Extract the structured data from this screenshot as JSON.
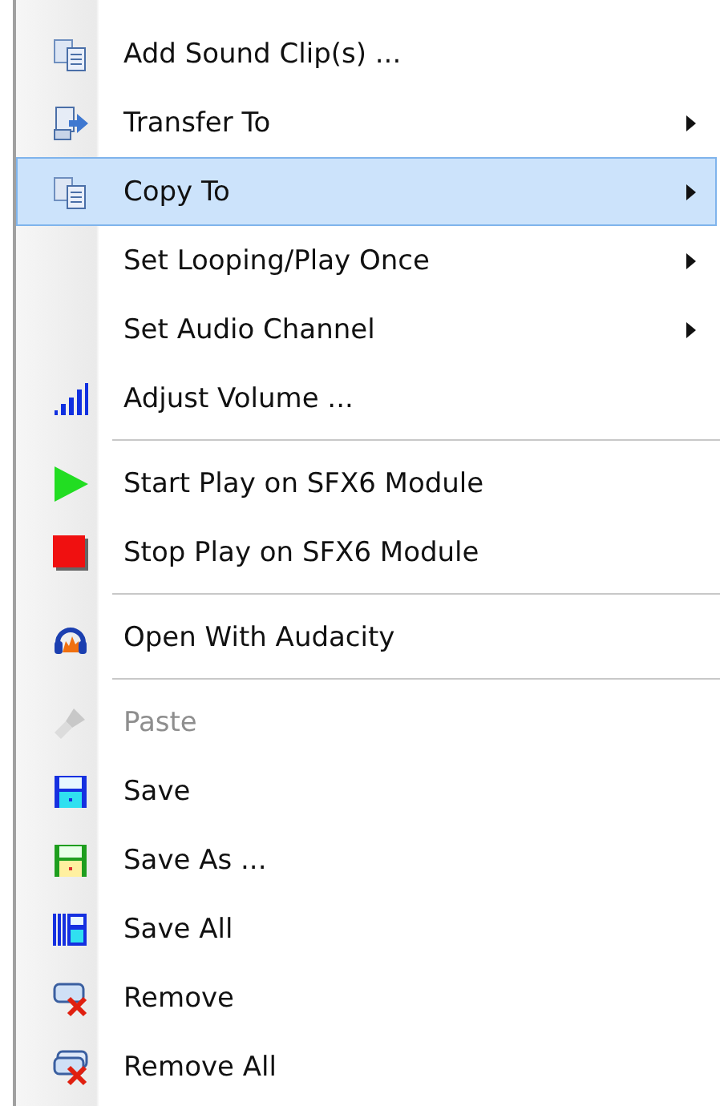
{
  "menu": {
    "items": [
      {
        "kind": "item",
        "label": "Add Sound Clip(s) ...",
        "submenu": false,
        "selected": false,
        "disabled": false
      },
      {
        "kind": "item",
        "label": "Transfer To",
        "submenu": true,
        "selected": false,
        "disabled": false
      },
      {
        "kind": "item",
        "label": "Copy To",
        "submenu": true,
        "selected": true,
        "disabled": false
      },
      {
        "kind": "item",
        "label": "Set Looping/Play Once",
        "submenu": true,
        "selected": false,
        "disabled": false
      },
      {
        "kind": "item",
        "label": "Set Audio Channel",
        "submenu": true,
        "selected": false,
        "disabled": false
      },
      {
        "kind": "item",
        "label": "Adjust Volume ...",
        "submenu": false,
        "selected": false,
        "disabled": false
      },
      {
        "kind": "separator"
      },
      {
        "kind": "item",
        "label": "Start Play on SFX6 Module",
        "submenu": false,
        "selected": false,
        "disabled": false
      },
      {
        "kind": "item",
        "label": "Stop Play on SFX6 Module",
        "submenu": false,
        "selected": false,
        "disabled": false
      },
      {
        "kind": "separator"
      },
      {
        "kind": "item",
        "label": "Open With Audacity",
        "submenu": false,
        "selected": false,
        "disabled": false
      },
      {
        "kind": "separator"
      },
      {
        "kind": "item",
        "label": "Paste",
        "submenu": false,
        "selected": false,
        "disabled": true
      },
      {
        "kind": "item",
        "label": "Save",
        "submenu": false,
        "selected": false,
        "disabled": false
      },
      {
        "kind": "item",
        "label": "Save As ...",
        "submenu": false,
        "selected": false,
        "disabled": false
      },
      {
        "kind": "item",
        "label": "Save All",
        "submenu": false,
        "selected": false,
        "disabled": false
      },
      {
        "kind": "item",
        "label": "Remove",
        "submenu": false,
        "selected": false,
        "disabled": false
      },
      {
        "kind": "item",
        "label": "Remove All",
        "submenu": false,
        "selected": false,
        "disabled": false
      }
    ]
  }
}
